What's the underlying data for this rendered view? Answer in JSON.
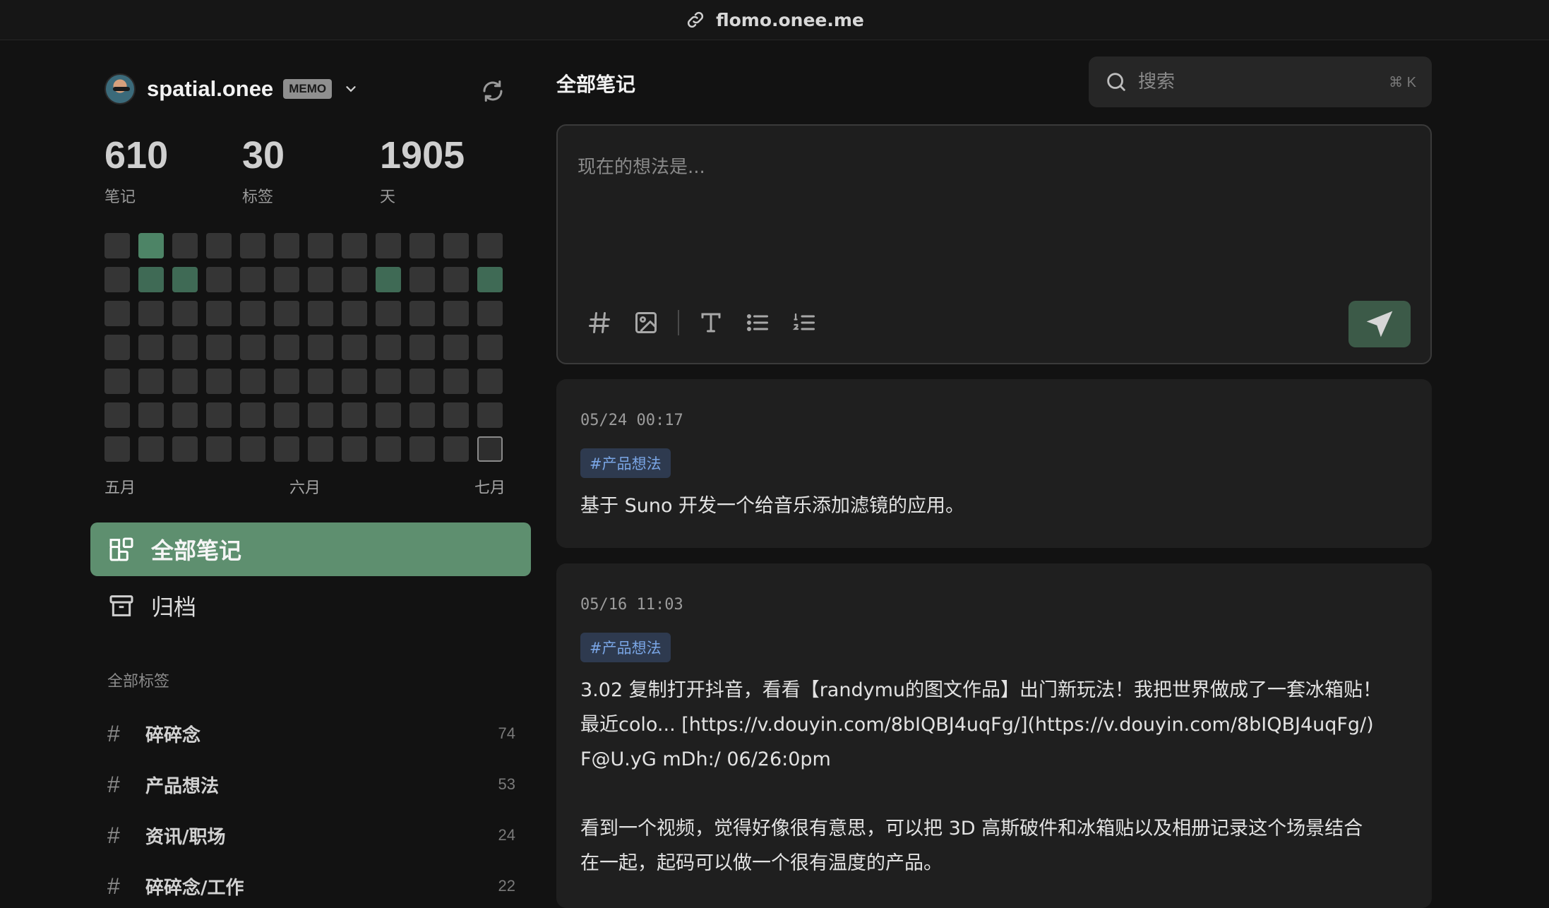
{
  "topbar": {
    "url": "flomo.onee.me"
  },
  "sidebar": {
    "username": "spatial.onee",
    "badge": "MEMO",
    "stats": [
      {
        "value": "610",
        "label": "笔记"
      },
      {
        "value": "30",
        "label": "标签"
      },
      {
        "value": "1905",
        "label": "天"
      }
    ],
    "heatmap_months": [
      "五月",
      "六月",
      "七月"
    ],
    "nav": [
      {
        "label": "全部笔记",
        "active": true
      },
      {
        "label": "归档",
        "active": false
      }
    ],
    "tags_header": "全部标签",
    "tags": [
      {
        "name": "碎碎念",
        "count": "74"
      },
      {
        "name": "产品想法",
        "count": "53"
      },
      {
        "name": "资讯/职场",
        "count": "24"
      },
      {
        "name": "碎碎念/工作",
        "count": "22"
      }
    ]
  },
  "main": {
    "title": "全部笔记",
    "search": {
      "placeholder": "搜索",
      "shortcut": "⌘ K"
    },
    "editor": {
      "placeholder": "现在的想法是..."
    },
    "notes": [
      {
        "time": "05/24 00:17",
        "tag": "#产品想法",
        "lines": [
          "基于 Suno 开发一个给音乐添加滤镜的应用。"
        ]
      },
      {
        "time": "05/16 11:03",
        "tag": "#产品想法",
        "lines": [
          "3.02 复制打开抖音，看看【randymu的图文作品】出门新玩法！我把世界做成了一套冰箱贴！",
          "最近colo... [https://v.douyin.com/8bIQBJ4uqFg/](https://v.douyin.com/8bIQBJ4uqFg/)",
          "F@U.yG mDh:/ 06/26:0pm",
          "",
          "看到一个视频，觉得好像很有意思，可以把 3D 高斯破件和冰箱贴以及相册记录这个场景结合",
          "在一起，起码可以做一个很有温度的产品。"
        ]
      }
    ]
  },
  "colors": {
    "accent": "#5e8f6f",
    "tag_bg": "#2e3a4f",
    "tag_text": "#7aa6e6"
  }
}
